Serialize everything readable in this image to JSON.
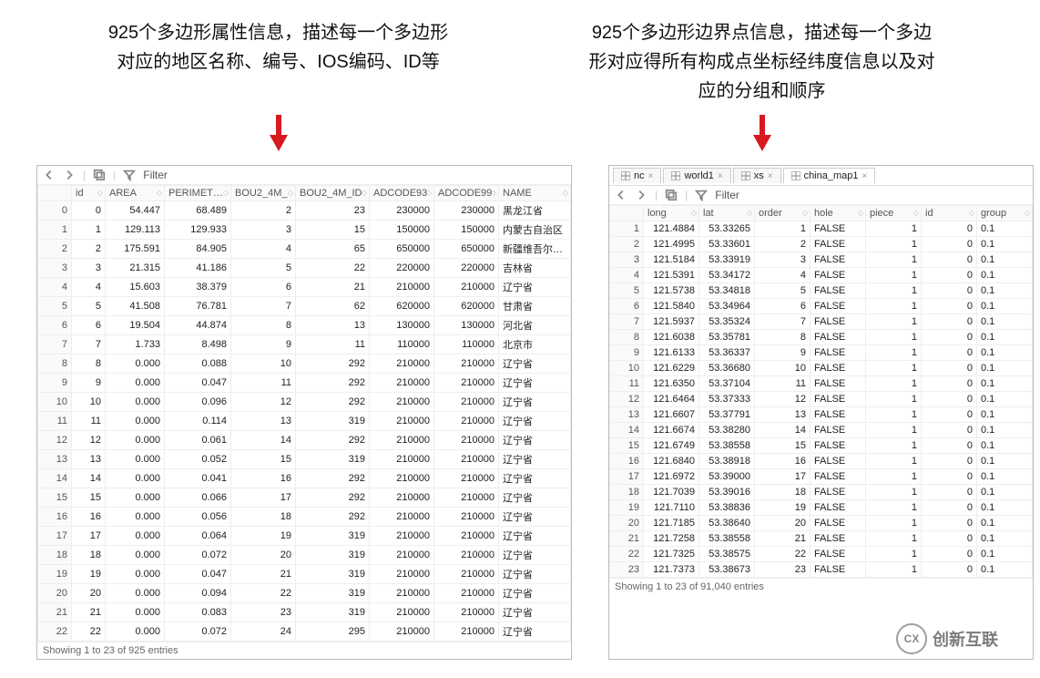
{
  "captions": {
    "left": "925个多边形属性信息，描述每一个多边形对应的地区名称、编号、IOS编码、ID等",
    "right": "925个多边形边界点信息，描述每一个多边形对应得所有构成点坐标经纬度信息以及对应的分组和顺序"
  },
  "arrow_color": "#d71920",
  "toolbar": {
    "filter_label": "Filter"
  },
  "tabs": {
    "items": [
      {
        "label": "nc"
      },
      {
        "label": "world1"
      },
      {
        "label": "xs"
      },
      {
        "label": "china_map1"
      }
    ],
    "active_index": 3
  },
  "left_table": {
    "headers": [
      "",
      "id",
      "AREA",
      "PERIMETER",
      "BOU2_4M_",
      "BOU2_4M_ID",
      "ADCODE93",
      "ADCODE99",
      "NAME"
    ],
    "rows": [
      [
        "0",
        "0",
        "54.447",
        "68.489",
        "2",
        "23",
        "230000",
        "230000",
        "黑龙江省"
      ],
      [
        "1",
        "1",
        "129.113",
        "129.933",
        "3",
        "15",
        "150000",
        "150000",
        "内蒙古自治区"
      ],
      [
        "2",
        "2",
        "175.591",
        "84.905",
        "4",
        "65",
        "650000",
        "650000",
        "新疆维吾尔自治区"
      ],
      [
        "3",
        "3",
        "21.315",
        "41.186",
        "5",
        "22",
        "220000",
        "220000",
        "吉林省"
      ],
      [
        "4",
        "4",
        "15.603",
        "38.379",
        "6",
        "21",
        "210000",
        "210000",
        "辽宁省"
      ],
      [
        "5",
        "5",
        "41.508",
        "76.781",
        "7",
        "62",
        "620000",
        "620000",
        "甘肃省"
      ],
      [
        "6",
        "6",
        "19.504",
        "44.874",
        "8",
        "13",
        "130000",
        "130000",
        "河北省"
      ],
      [
        "7",
        "7",
        "1.733",
        "8.498",
        "9",
        "11",
        "110000",
        "110000",
        "北京市"
      ],
      [
        "8",
        "8",
        "0.000",
        "0.088",
        "10",
        "292",
        "210000",
        "210000",
        "辽宁省"
      ],
      [
        "9",
        "9",
        "0.000",
        "0.047",
        "11",
        "292",
        "210000",
        "210000",
        "辽宁省"
      ],
      [
        "10",
        "10",
        "0.000",
        "0.096",
        "12",
        "292",
        "210000",
        "210000",
        "辽宁省"
      ],
      [
        "11",
        "11",
        "0.000",
        "0.114",
        "13",
        "319",
        "210000",
        "210000",
        "辽宁省"
      ],
      [
        "12",
        "12",
        "0.000",
        "0.061",
        "14",
        "292",
        "210000",
        "210000",
        "辽宁省"
      ],
      [
        "13",
        "13",
        "0.000",
        "0.052",
        "15",
        "319",
        "210000",
        "210000",
        "辽宁省"
      ],
      [
        "14",
        "14",
        "0.000",
        "0.041",
        "16",
        "292",
        "210000",
        "210000",
        "辽宁省"
      ],
      [
        "15",
        "15",
        "0.000",
        "0.066",
        "17",
        "292",
        "210000",
        "210000",
        "辽宁省"
      ],
      [
        "16",
        "16",
        "0.000",
        "0.056",
        "18",
        "292",
        "210000",
        "210000",
        "辽宁省"
      ],
      [
        "17",
        "17",
        "0.000",
        "0.064",
        "19",
        "319",
        "210000",
        "210000",
        "辽宁省"
      ],
      [
        "18",
        "18",
        "0.000",
        "0.072",
        "20",
        "319",
        "210000",
        "210000",
        "辽宁省"
      ],
      [
        "19",
        "19",
        "0.000",
        "0.047",
        "21",
        "319",
        "210000",
        "210000",
        "辽宁省"
      ],
      [
        "20",
        "20",
        "0.000",
        "0.094",
        "22",
        "319",
        "210000",
        "210000",
        "辽宁省"
      ],
      [
        "21",
        "21",
        "0.000",
        "0.083",
        "23",
        "319",
        "210000",
        "210000",
        "辽宁省"
      ],
      [
        "22",
        "22",
        "0.000",
        "0.072",
        "24",
        "295",
        "210000",
        "210000",
        "辽宁省"
      ]
    ],
    "status": "Showing 1 to 23 of 925 entries"
  },
  "right_table": {
    "headers": [
      "",
      "long",
      "lat",
      "order",
      "hole",
      "piece",
      "id",
      "group"
    ],
    "rows": [
      [
        "1",
        "121.4884",
        "53.33265",
        "1",
        "FALSE",
        "1",
        "0",
        "0.1"
      ],
      [
        "2",
        "121.4995",
        "53.33601",
        "2",
        "FALSE",
        "1",
        "0",
        "0.1"
      ],
      [
        "3",
        "121.5184",
        "53.33919",
        "3",
        "FALSE",
        "1",
        "0",
        "0.1"
      ],
      [
        "4",
        "121.5391",
        "53.34172",
        "4",
        "FALSE",
        "1",
        "0",
        "0.1"
      ],
      [
        "5",
        "121.5738",
        "53.34818",
        "5",
        "FALSE",
        "1",
        "0",
        "0.1"
      ],
      [
        "6",
        "121.5840",
        "53.34964",
        "6",
        "FALSE",
        "1",
        "0",
        "0.1"
      ],
      [
        "7",
        "121.5937",
        "53.35324",
        "7",
        "FALSE",
        "1",
        "0",
        "0.1"
      ],
      [
        "8",
        "121.6038",
        "53.35781",
        "8",
        "FALSE",
        "1",
        "0",
        "0.1"
      ],
      [
        "9",
        "121.6133",
        "53.36337",
        "9",
        "FALSE",
        "1",
        "0",
        "0.1"
      ],
      [
        "10",
        "121.6229",
        "53.36680",
        "10",
        "FALSE",
        "1",
        "0",
        "0.1"
      ],
      [
        "11",
        "121.6350",
        "53.37104",
        "11",
        "FALSE",
        "1",
        "0",
        "0.1"
      ],
      [
        "12",
        "121.6464",
        "53.37333",
        "12",
        "FALSE",
        "1",
        "0",
        "0.1"
      ],
      [
        "13",
        "121.6607",
        "53.37791",
        "13",
        "FALSE",
        "1",
        "0",
        "0.1"
      ],
      [
        "14",
        "121.6674",
        "53.38280",
        "14",
        "FALSE",
        "1",
        "0",
        "0.1"
      ],
      [
        "15",
        "121.6749",
        "53.38558",
        "15",
        "FALSE",
        "1",
        "0",
        "0.1"
      ],
      [
        "16",
        "121.6840",
        "53.38918",
        "16",
        "FALSE",
        "1",
        "0",
        "0.1"
      ],
      [
        "17",
        "121.6972",
        "53.39000",
        "17",
        "FALSE",
        "1",
        "0",
        "0.1"
      ],
      [
        "18",
        "121.7039",
        "53.39016",
        "18",
        "FALSE",
        "1",
        "0",
        "0.1"
      ],
      [
        "19",
        "121.7110",
        "53.38836",
        "19",
        "FALSE",
        "1",
        "0",
        "0.1"
      ],
      [
        "20",
        "121.7185",
        "53.38640",
        "20",
        "FALSE",
        "1",
        "0",
        "0.1"
      ],
      [
        "21",
        "121.7258",
        "53.38558",
        "21",
        "FALSE",
        "1",
        "0",
        "0.1"
      ],
      [
        "22",
        "121.7325",
        "53.38575",
        "22",
        "FALSE",
        "1",
        "0",
        "0.1"
      ],
      [
        "23",
        "121.7373",
        "53.38673",
        "23",
        "FALSE",
        "1",
        "0",
        "0.1"
      ]
    ],
    "status": "Showing 1 to 23 of 91,040 entries"
  },
  "watermark": {
    "badge": "CX",
    "text": "创新互联"
  }
}
